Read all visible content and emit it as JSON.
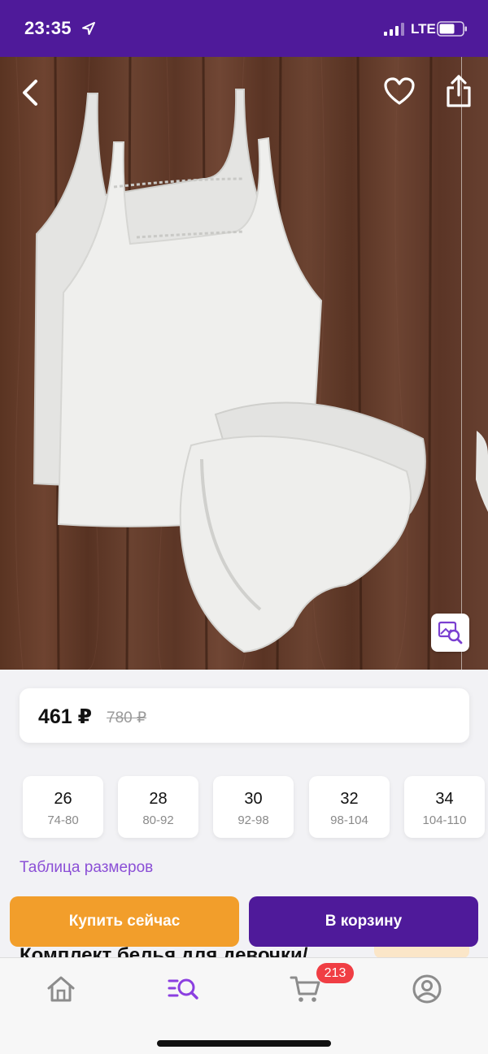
{
  "status_bar": {
    "time": "23:35",
    "network": "LTE",
    "icons": [
      "location-arrow-icon",
      "signal-bars-icon",
      "battery-icon"
    ]
  },
  "product_image": {
    "icons": [
      "chevron-left-icon",
      "heart-icon",
      "share-icon",
      "image-search-icon"
    ]
  },
  "price": {
    "current": "461 ₽",
    "old": "780 ₽"
  },
  "sizes": [
    {
      "size": "26",
      "range": "74-80"
    },
    {
      "size": "28",
      "range": "80-92"
    },
    {
      "size": "30",
      "range": "92-98"
    },
    {
      "size": "32",
      "range": "98-104"
    },
    {
      "size": "34",
      "range": "104-110"
    }
  ],
  "size_table_link": "Таблица размеров",
  "product_title": "Комплект белья для девочки/",
  "actions": {
    "buy_now": "Купить сейчас",
    "add_to_cart": "В корзину"
  },
  "tab_bar": {
    "cart_count": "213",
    "icons": [
      "home-icon",
      "catalog-search-icon",
      "cart-icon",
      "profile-icon"
    ]
  },
  "colors": {
    "brand_purple": "#4f1a9a",
    "buy_orange": "#f29e2b",
    "link_purple": "#8b4fd6",
    "badge_red": "#f03e44"
  }
}
